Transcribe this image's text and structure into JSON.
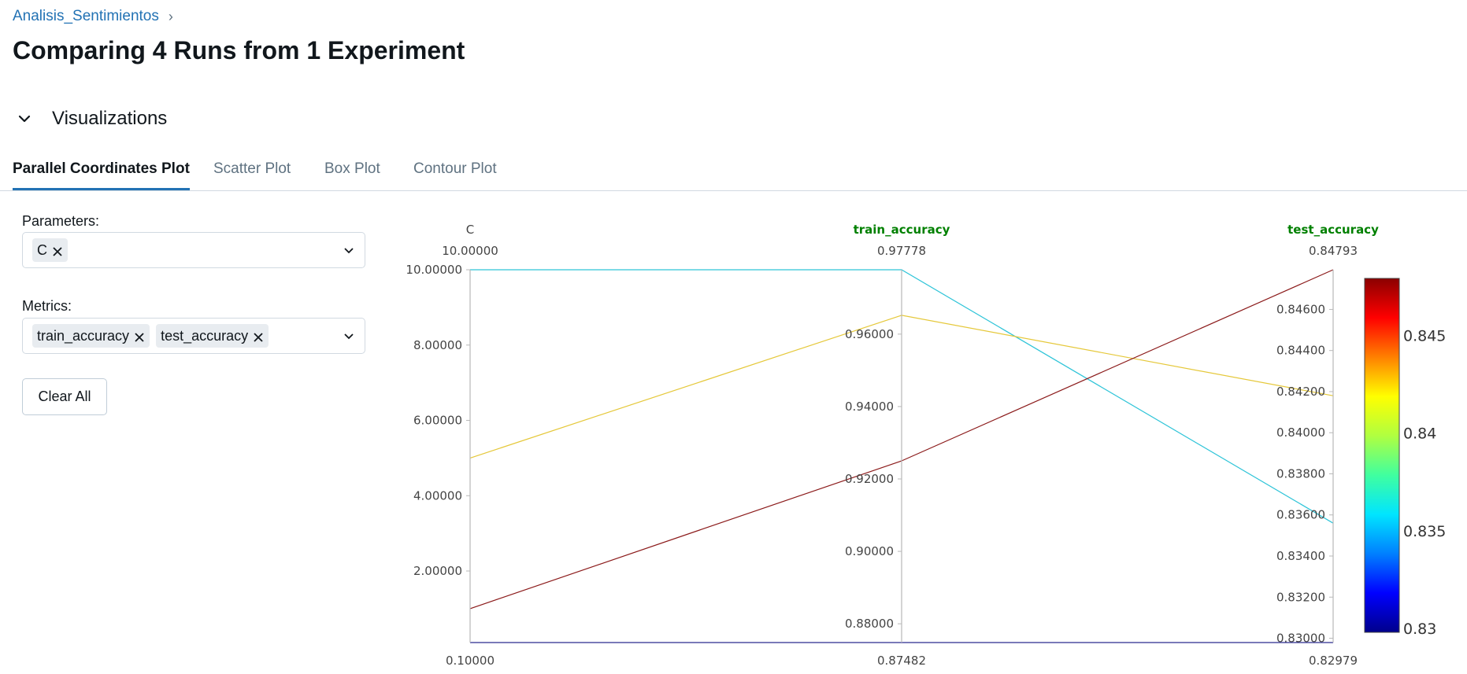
{
  "breadcrumb": {
    "experiment": "Analisis_Sentimientos",
    "separator": "›"
  },
  "page_title": "Comparing 4 Runs from 1 Experiment",
  "section": {
    "label": "Visualizations"
  },
  "tabs": [
    {
      "label": "Parallel Coordinates Plot",
      "active": true
    },
    {
      "label": "Scatter Plot",
      "active": false
    },
    {
      "label": "Box Plot",
      "active": false
    },
    {
      "label": "Contour Plot",
      "active": false
    }
  ],
  "controls": {
    "parameters_label": "Parameters:",
    "parameters_selected": [
      "C"
    ],
    "metrics_label": "Metrics:",
    "metrics_selected": [
      "train_accuracy",
      "test_accuracy"
    ],
    "clear_all_label": "Clear All"
  },
  "colors": {
    "link": "#2272b4",
    "active_tab": "#2272b4",
    "metric_title": "#008000"
  },
  "chart_data": {
    "type": "parallel_coordinates",
    "dimensions": [
      {
        "name": "C",
        "is_metric": false,
        "range": [
          0.1,
          10.0
        ],
        "range_labels": [
          "0.10000",
          "10.00000"
        ],
        "tick_values": [
          2,
          4,
          6,
          8,
          10
        ],
        "ticks": [
          "2.00000",
          "4.00000",
          "6.00000",
          "8.00000",
          "10.00000"
        ]
      },
      {
        "name": "train_accuracy",
        "is_metric": true,
        "range": [
          0.87482,
          0.97778
        ],
        "range_labels": [
          "0.87482",
          "0.97778"
        ],
        "tick_values": [
          0.88,
          0.9,
          0.92,
          0.94,
          0.96
        ],
        "ticks": [
          "0.88000",
          "0.90000",
          "0.92000",
          "0.94000",
          "0.96000"
        ]
      },
      {
        "name": "test_accuracy",
        "is_metric": true,
        "range": [
          0.82979,
          0.84793
        ],
        "range_labels": [
          "0.82979",
          "0.84793"
        ],
        "tick_values": [
          0.83,
          0.832,
          0.834,
          0.836,
          0.838,
          0.84,
          0.842,
          0.844,
          0.846
        ],
        "ticks": [
          "0.83000",
          "0.83200",
          "0.83400",
          "0.83600",
          "0.83800",
          "0.84000",
          "0.84200",
          "0.84400",
          "0.84600"
        ]
      }
    ],
    "lines": [
      {
        "values": [
          10.0,
          0.97778,
          0.8356
        ],
        "color": "#2ec4d8"
      },
      {
        "values": [
          5.0,
          0.9652,
          0.8418
        ],
        "color": "#e5c83a"
      },
      {
        "values": [
          1.0,
          0.925,
          0.84793
        ],
        "color": "#8b1a1a"
      },
      {
        "values": [
          0.1,
          0.87482,
          0.82979
        ],
        "color": "#2a2a8f"
      }
    ],
    "colorbar": {
      "metric": "test_accuracy",
      "range": [
        0.82979,
        0.84793
      ],
      "tick_values": [
        0.83,
        0.835,
        0.84,
        0.845
      ],
      "ticks": [
        "0.83",
        "0.835",
        "0.84",
        "0.845"
      ],
      "colorscale": [
        "#00008b",
        "#0000ff",
        "#0080ff",
        "#00e5ff",
        "#40ff9f",
        "#b0ff40",
        "#ffff00",
        "#ff8000",
        "#ff0000",
        "#8b0000"
      ]
    }
  }
}
